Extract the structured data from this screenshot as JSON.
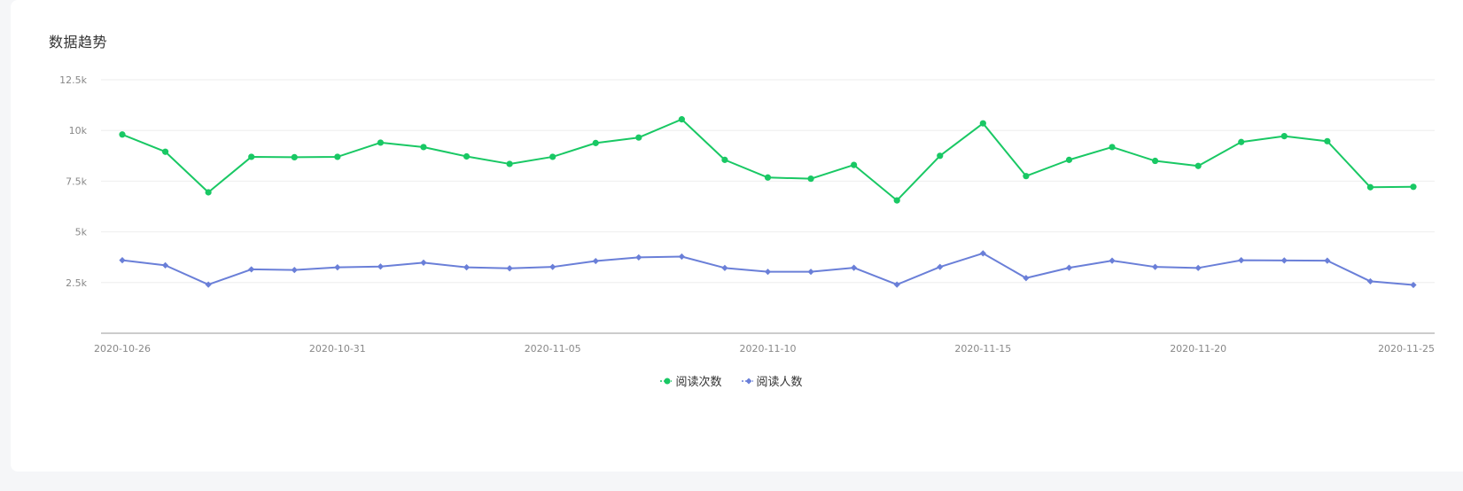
{
  "card": {
    "title": "数据趋势"
  },
  "chart_data": {
    "type": "line",
    "title": "数据趋势",
    "xlabel": "",
    "ylabel": "",
    "x": [
      "2020-10-26",
      "2020-10-27",
      "2020-10-28",
      "2020-10-29",
      "2020-10-30",
      "2020-10-31",
      "2020-11-01",
      "2020-11-02",
      "2020-11-03",
      "2020-11-04",
      "2020-11-05",
      "2020-11-06",
      "2020-11-07",
      "2020-11-08",
      "2020-11-09",
      "2020-11-10",
      "2020-11-11",
      "2020-11-12",
      "2020-11-13",
      "2020-11-14",
      "2020-11-15",
      "2020-11-16",
      "2020-11-17",
      "2020-11-18",
      "2020-11-19",
      "2020-11-20",
      "2020-11-21",
      "2020-11-22",
      "2020-11-23",
      "2020-11-24",
      "2020-11-25"
    ],
    "x_tick_labels": [
      "2020-10-26",
      "2020-10-31",
      "2020-11-05",
      "2020-11-10",
      "2020-11-15",
      "2020-11-20",
      "2020-11-25"
    ],
    "y_ticks": [
      2500,
      5000,
      7500,
      10000,
      12500
    ],
    "y_tick_labels": [
      "2.5k",
      "5k",
      "7.5k",
      "10k",
      "12.5k"
    ],
    "ylim": [
      0,
      12500
    ],
    "grid": true,
    "legend_position": "bottom-center",
    "series": [
      {
        "name": "阅读次数",
        "color": "#19c864",
        "marker": "circle",
        "values": [
          9800,
          8950,
          6950,
          8700,
          8680,
          8700,
          9400,
          9180,
          8720,
          8350,
          8700,
          9380,
          9650,
          10550,
          8550,
          7680,
          7620,
          8300,
          6550,
          8750,
          10350,
          7750,
          8550,
          9180,
          8500,
          8250,
          9430,
          9720,
          9470,
          7200,
          7220
        ]
      },
      {
        "name": "阅读人数",
        "color": "#6a7fd8",
        "marker": "diamond",
        "values": [
          3600,
          3350,
          2400,
          3150,
          3120,
          3250,
          3290,
          3480,
          3250,
          3200,
          3270,
          3560,
          3740,
          3780,
          3220,
          3030,
          3030,
          3230,
          2400,
          3270,
          3940,
          2720,
          3230,
          3580,
          3270,
          3220,
          3600,
          3590,
          3580,
          2560,
          2380
        ]
      }
    ]
  }
}
